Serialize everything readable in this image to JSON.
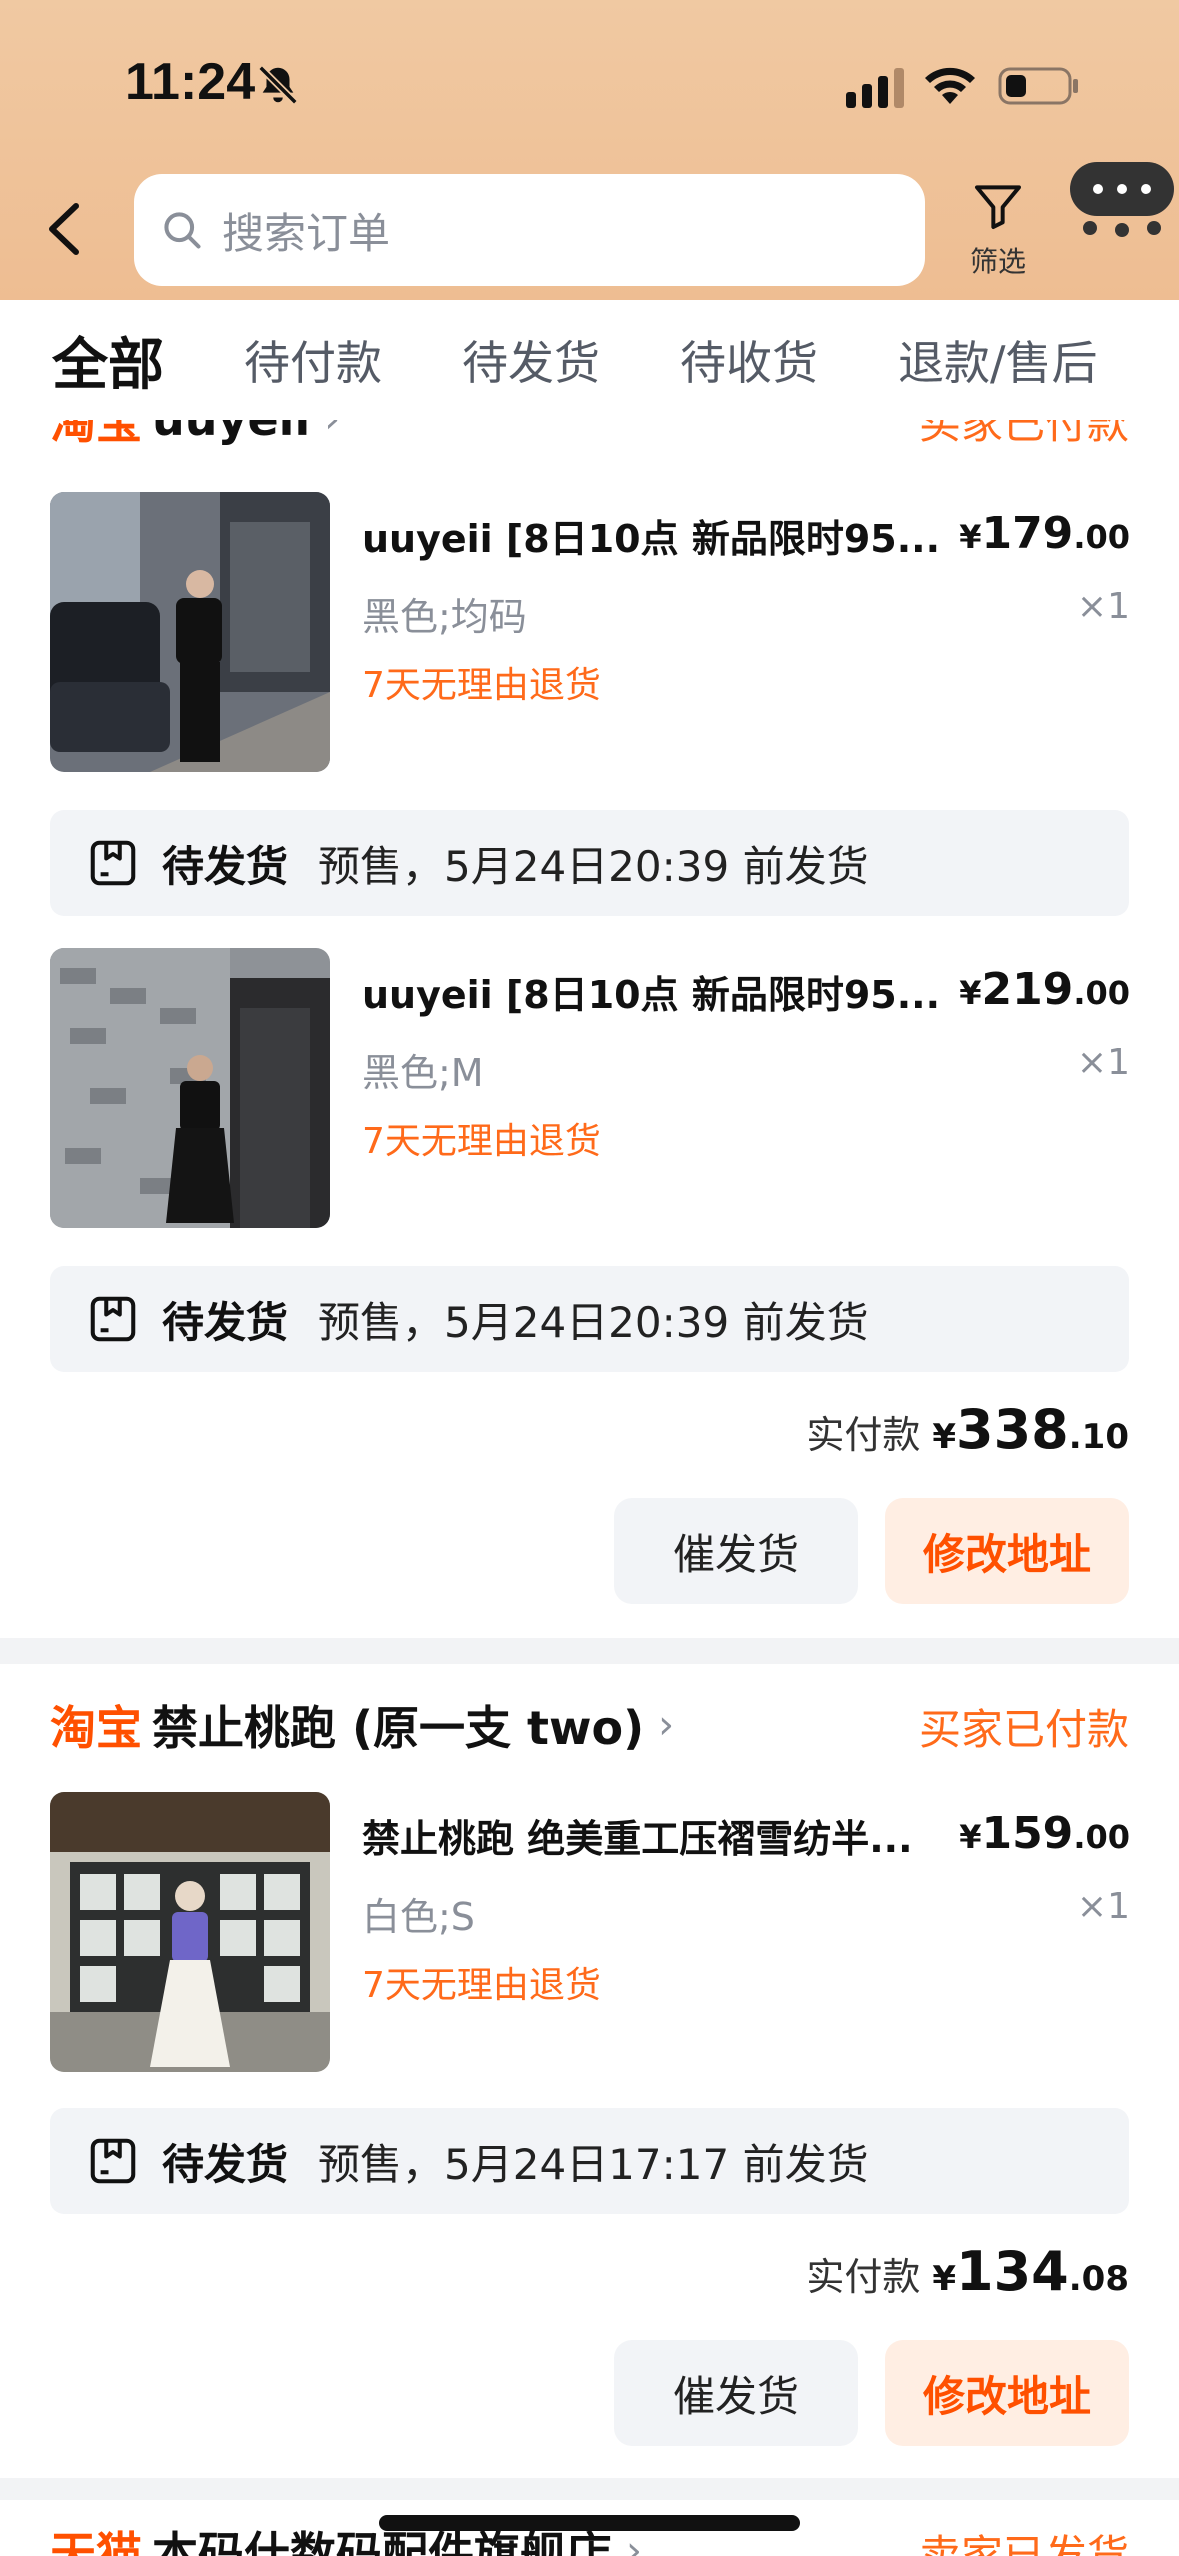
{
  "status_bar": {
    "time": "11:24",
    "icons": [
      "bell-slash-icon",
      "signal-icon",
      "wifi-icon",
      "battery-icon"
    ]
  },
  "header": {
    "search_placeholder": "搜索订单",
    "filter_label": "筛选",
    "icons": [
      "back-icon",
      "search-icon",
      "filter-icon",
      "chat-icon"
    ]
  },
  "tabs": [
    "全部",
    "待付款",
    "待发货",
    "待收货",
    "退款/售后"
  ],
  "colors": {
    "accent": "#ff5000",
    "status": "#ff6a1a",
    "header_bg": "#f0c9a2"
  },
  "orders": [
    {
      "platform": "淘宝",
      "shop": "uuyeii",
      "status": "买家已付款",
      "items": [
        {
          "title": "uuyeii [8日10点  新品限时95...",
          "price_symbol": "¥",
          "price_int": "179",
          "price_dec": ".00",
          "sku": "黑色;均码",
          "qty": "×1",
          "return": "7天无理由退货",
          "ship_status": "待发货",
          "ship_text": "预售，5月24日20:39 前发货"
        },
        {
          "title": "uuyeii [8日10点  新品限时95...",
          "price_symbol": "¥",
          "price_int": "219",
          "price_dec": ".00",
          "sku": "黑色;M",
          "qty": "×1",
          "return": "7天无理由退货",
          "ship_status": "待发货",
          "ship_text": "预售，5月24日20:39 前发货"
        }
      ],
      "total_label": "实付款",
      "total_symbol": "¥",
      "total_int": "338",
      "total_dec": ".10",
      "button_urge": "催发货",
      "button_address": "修改地址"
    },
    {
      "platform": "淘宝",
      "shop": "禁止桃跑 (原一支 two)",
      "status": "买家已付款",
      "items": [
        {
          "title": "禁止桃跑 绝美重工压褶雪纺半...",
          "price_symbol": "¥",
          "price_int": "159",
          "price_dec": ".00",
          "sku": "白色;S",
          "qty": "×1",
          "return": "7天无理由退货",
          "ship_status": "待发货",
          "ship_text": "预售，5月24日17:17 前发货"
        }
      ],
      "total_label": "实付款",
      "total_symbol": "¥",
      "total_int": "134",
      "total_dec": ".08",
      "button_urge": "催发货",
      "button_address": "修改地址"
    },
    {
      "platform": "天猫",
      "shop": "本码什数码配件旗舰店",
      "status": "卖家已发货"
    }
  ]
}
